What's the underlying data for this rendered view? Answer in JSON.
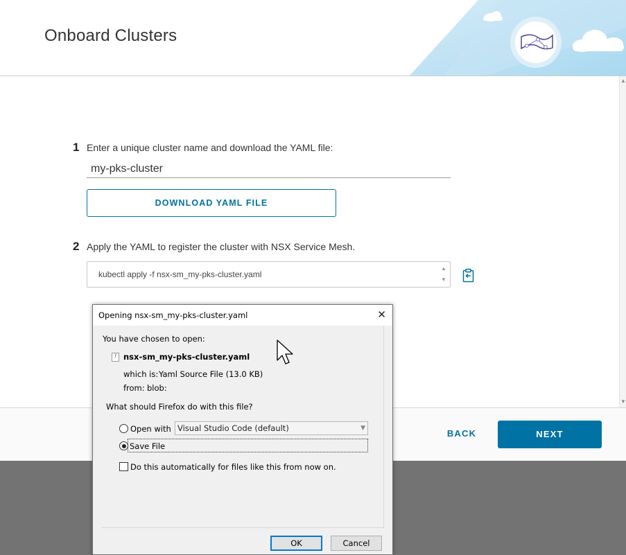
{
  "header": {
    "title": "Onboard Clusters"
  },
  "step1": {
    "number": "1",
    "instruction": "Enter a unique cluster name and download the YAML file:",
    "cluster_name_value": "my-pks-cluster",
    "download_button": "DOWNLOAD YAML FILE"
  },
  "step2": {
    "number": "2",
    "instruction": "Apply the YAML to register the cluster with NSX Service Mesh.",
    "command": "kubectl apply -f nsx-sm_my-pks-cluster.yaml"
  },
  "footer": {
    "back_label": "BACK",
    "next_label": "NEXT"
  },
  "dialog": {
    "title": "Opening nsx-sm_my-pks-cluster.yaml",
    "close_glyph": "✕",
    "chosen_text": "You have chosen to open:",
    "file_name": "nsx-sm_my-pks-cluster.yaml",
    "which_is_label": "which is:",
    "which_is_value": "Yaml Source File (13.0 KB)",
    "from_label": "from:",
    "from_value": "blob:",
    "question": "What should Firefox do with this file?",
    "open_with_label": "Open with",
    "open_with_app": "Visual Studio Code (default)",
    "save_file_label": "Save File",
    "auto_label": "Do this automatically for files like this from now on.",
    "ok_label": "OK",
    "cancel_label": "Cancel",
    "selected_option": "save_file",
    "auto_checked": false
  },
  "colors": {
    "accent": "#0072a3",
    "overlay": "#737373"
  }
}
